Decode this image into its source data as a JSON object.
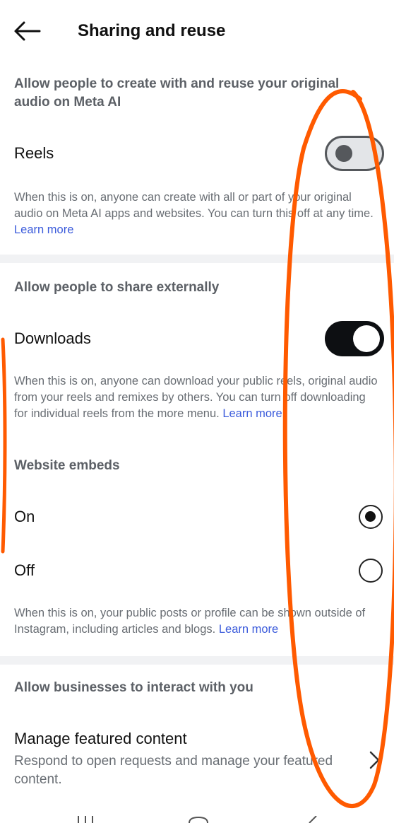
{
  "header": {
    "title": "Sharing and reuse",
    "back_icon": "arrow-left-icon"
  },
  "section_meta_ai": {
    "heading": "Allow people to create with and reuse your original audio on Meta AI",
    "reels_label": "Reels",
    "reels_toggle": "off",
    "description": "When this is on, anyone can create with all or part of your original audio on Meta AI apps and websites. You can turn this off at any time.",
    "learn_more": "Learn more"
  },
  "section_external": {
    "heading": "Allow people to share externally",
    "downloads_label": "Downloads",
    "downloads_toggle": "on",
    "downloads_description": "When this is on, anyone can download your public reels, original audio from your reels and remixes by others. You can turn off downloading for individual reels from the more menu.",
    "downloads_learn_more": "Learn more",
    "embeds_heading": "Website embeds",
    "embed_options": [
      {
        "label": "On",
        "selected": true
      },
      {
        "label": "Off",
        "selected": false
      }
    ],
    "embeds_description": "When this is on, your public posts or profile can be shown outside of Instagram, including articles and blogs.",
    "embeds_learn_more": "Learn more"
  },
  "section_business": {
    "heading": "Allow businesses to interact with you",
    "featured_label": "Manage featured content",
    "featured_description": "Respond to open requests and manage your featured content.",
    "chevron_icon": "chevron-right-icon"
  },
  "colors": {
    "annotation": "#ff5a00",
    "link": "#3b5bdb",
    "toggle_on": "#0d0f12"
  }
}
